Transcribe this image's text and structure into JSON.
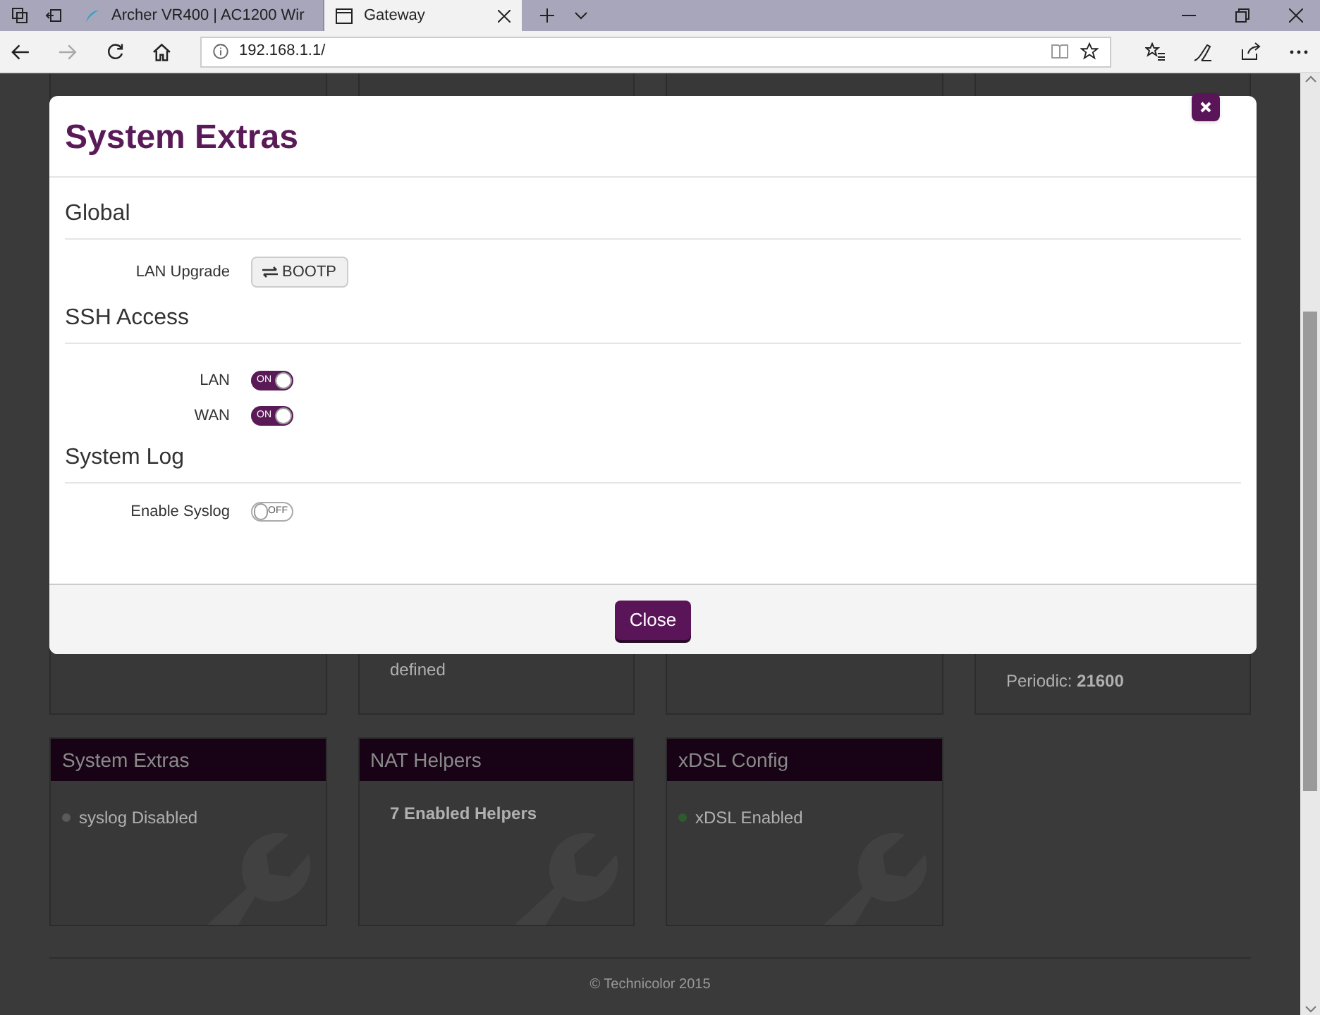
{
  "browser": {
    "tabs": [
      {
        "title": "Archer VR400 | AC1200 Wir",
        "selected": false
      },
      {
        "title": "Gateway",
        "selected": true
      }
    ],
    "address": "192.168.1.1/"
  },
  "top_cards": [
    {
      "kind": "empty"
    },
    {
      "kind": "text",
      "text": "defined"
    },
    {
      "kind": "empty"
    },
    {
      "kind": "pair",
      "label": "Periodic:",
      "value": "21600"
    }
  ],
  "cards": [
    {
      "title": "System Extras",
      "kind": "status",
      "text": "syslog Disabled",
      "color": "#5a5a5a"
    },
    {
      "title": "NAT Helpers",
      "kind": "bold",
      "text": "7 Enabled Helpers"
    },
    {
      "title": "xDSL Config",
      "kind": "status",
      "text": "xDSL Enabled",
      "color": "#2e5a2e"
    }
  ],
  "footer": "© Technicolor 2015",
  "modal": {
    "title": "System Extras",
    "sections": [
      {
        "title": "Global",
        "rows": [
          {
            "kind": "button",
            "label": "LAN Upgrade",
            "button": "BOOTP"
          }
        ]
      },
      {
        "title": "SSH Access",
        "rows": [
          {
            "kind": "switch",
            "label": "LAN",
            "on": true,
            "switch_text": "ON"
          },
          {
            "kind": "switch",
            "label": "WAN",
            "on": true,
            "switch_text": "ON"
          }
        ]
      },
      {
        "title": "System Log",
        "rows": [
          {
            "kind": "switch",
            "label": "Enable Syslog",
            "on": false,
            "switch_text": "OFF"
          }
        ]
      }
    ],
    "close_button": "Close"
  }
}
